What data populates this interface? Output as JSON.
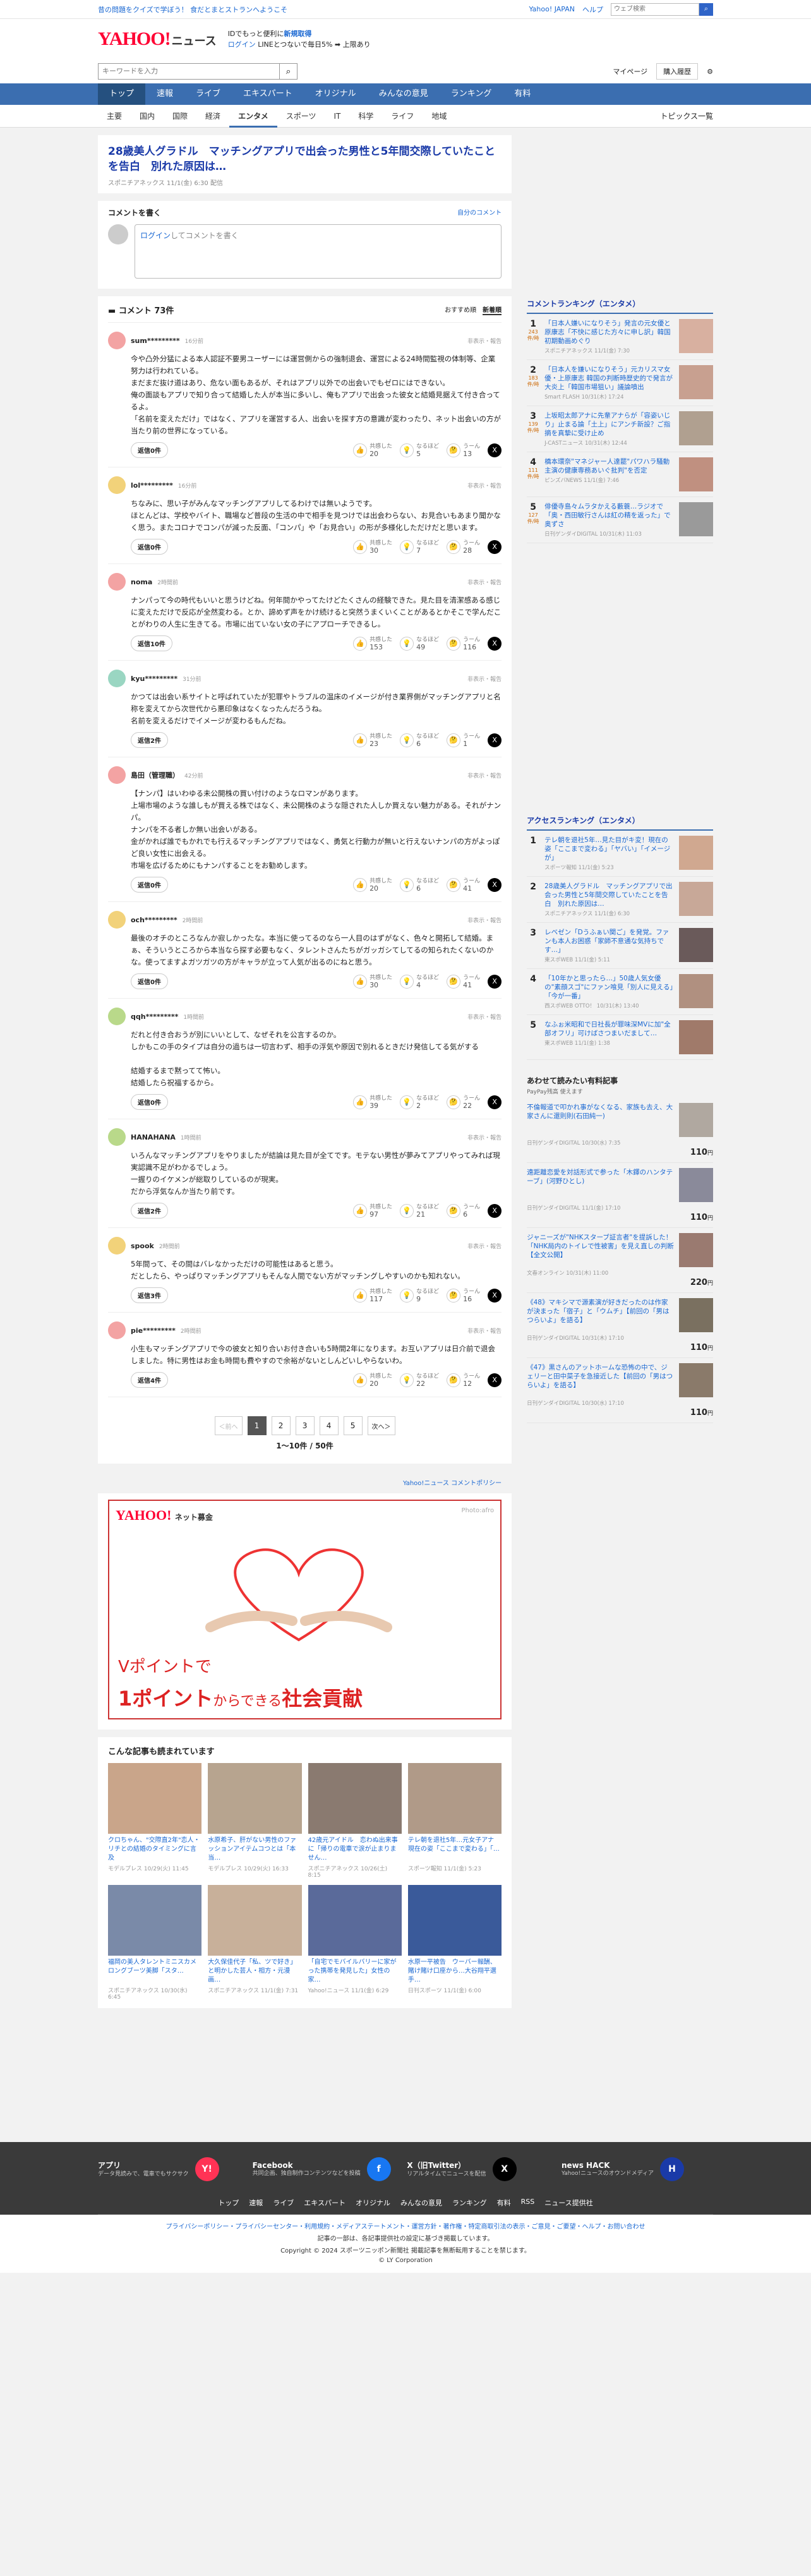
{
  "topbar": {
    "left": "昔の問題をクイズで学ぼう！ 食だとまとストランへようこそ",
    "links": [
      "Yahoo! JAPAN",
      "ヘルプ"
    ],
    "search_placeholder": "ウェブ検索"
  },
  "header": {
    "logo": "YAHOO!",
    "logo_sub": "JAPAN",
    "section": "ニュース",
    "promo_line1": "IDでもっと便利に",
    "promo_new": "新規取得",
    "promo_line2_a": "ログイン",
    "promo_line2_b": "LINEとつないで毎日5% ➡ 上限あり"
  },
  "search": {
    "placeholder": "キーワードを入力",
    "mypage": "マイページ",
    "buy": "購入履歴"
  },
  "mainnav": [
    "トップ",
    "速報",
    "ライブ",
    "エキスパート",
    "オリジナル",
    "みんなの意見",
    "ランキング",
    "有料"
  ],
  "subnav": [
    "主要",
    "国内",
    "国際",
    "経済",
    "エンタメ",
    "スポーツ",
    "IT",
    "科学",
    "ライフ",
    "地域"
  ],
  "subnav_right": "トピックス一覧",
  "article": {
    "title": "28歳美人グラドル　マッチングアプリで出会った男性と5年間交際していたことを告白　別れた原因は…",
    "meta": "スポニチアネックス 11/1(金) 6:30 配信"
  },
  "write": {
    "title": "コメントを書く",
    "policy": "自分のコメント",
    "login": "ログイン",
    "placeholder": "してコメントを書く"
  },
  "comments": {
    "title": "コメント 73件",
    "sort": [
      "おすすめ順",
      "新着順"
    ],
    "items": [
      {
        "name": "sum*********",
        "time": "16分前",
        "report": "非表示・報告",
        "color": "#f3a3a3",
        "body": "今や凸外分猛による本人認証不要男ユーザーには運営側からの強制退会、運営による24時間監視の体制等、企業努力は行われている。\nまだまだ抜け道はあり、危ない面もあるが、それはアプリ以外での出会いでもゼロにはできない。\n俺の面談もアプリで知り合って結婚した人が本当に多いし、俺もアプリで出会った彼女と結婚見据えて付き合ってるよ。\n「名前を変えただけ」ではなく、アプリを運営する人、出会いを探す方の意識が変わったり、ネット出会いの方が当たり前の世界になっている。",
        "reply": "返信0件",
        "r1": "20",
        "r2": "5",
        "r3": "13"
      },
      {
        "name": "lol*********",
        "time": "16分前",
        "report": "非表示・報告",
        "color": "#f2d27a",
        "body": "ちなみに、思い子がみんなマッチングアプリしてるわけでは無いようです。\nほとんどは、学校やバイト、職場など普段の生活の中で相手を見つけでは出会わらない、お見合いもあまり聞かなく思う。またコロナでコンパが減った反面、「コンパ」や「お見合い」の形が多様化しただけだと思います。",
        "reply": "返信0件",
        "r1": "30",
        "r2": "7",
        "r3": "28"
      },
      {
        "name": "noma",
        "time": "2時間前",
        "report": "非表示・報告",
        "color": "#f3a3a3",
        "body": "ナンパって今の時代もいいと思うけどね。何年間かやってたけどたくさんの経験できた。見た目を清潔感ある感じに変えただけで反応が全然変わる。とか、諦めず声をかけ続けると突然うまくいくことがあるとかそこで学んだことがわりの人生に生きてる。市場に出ていない女の子にアプローチできるし。",
        "reply": "返信10件",
        "r1": "153",
        "r2": "49",
        "r3": "116"
      },
      {
        "name": "kyu*********",
        "time": "31分前",
        "report": "非表示・報告",
        "color": "#9ad6c2",
        "body": "かつては出会い系サイトと呼ばれていたが犯罪やトラブルの温床のイメージが付き業界側がマッチングアプリと名称を変えてから次世代から悪印象はなくなったんだろうね。\n名前を変えるだけでイメージが変わるもんだね。",
        "reply": "返信2件",
        "r1": "23",
        "r2": "6",
        "r3": "1"
      },
      {
        "name": "島田（管理職）",
        "time": "42分前",
        "report": "非表示・報告",
        "color": "#f3a3a3",
        "body": "【ナンパ】はいわゆる未公開株の買い付けのようなロマンがあります。\n上場市場のような誰しもが買える株ではなく、未公開株のような隠された人しか買えない魅力がある。それがナンパ。\nナンパを不る者しか無い出会いがある。\n金がかれば誰でもかれでも行えるマッチングアプリではなく、勇気と行動力が無いと行えないナンパの方がよっぽど良い女性に出会える。\n市場を広げるためにもナンパすることをお勧めします。",
        "reply": "返信0件",
        "r1": "20",
        "r2": "6",
        "r3": "41"
      },
      {
        "name": "och*********",
        "time": "2時間前",
        "report": "非表示・報告",
        "color": "#f2d27a",
        "body": "最後のオチのところなんか寂しかったな。本当に使ってるのなら一人目のはずがなく、色々と開拓して結婚。まぁ、そういうところから本当なら探す必要もなく、タレントさんたちがガッガシてしてるの知られたくないのかな。使ってますよガツガツの方がキャラが立って人気が出るのにねと思う。",
        "reply": "返信0件",
        "r1": "30",
        "r2": "4",
        "r3": "41"
      },
      {
        "name": "qqh*********",
        "time": "1時間前",
        "report": "非表示・報告",
        "color": "#b9d98a",
        "body": "だれと付き合おうが別にいいとして、なぜそれを公言するのか。\nしかもこの手のタイプは自分の過ちは一切言わず、相手の浮気や原因で別れるときだけ発信してる気がする\n\n結婚するまで黙ってて怖い。\n結婚したら祝福するから。",
        "reply": "返信0件",
        "r1": "39",
        "r2": "2",
        "r3": "22"
      },
      {
        "name": "HANAHANA",
        "time": "1時間前",
        "report": "非表示・報告",
        "color": "#b9d98a",
        "body": "いろんなマッチングアプリをやりましたが結論は見た目が全てです。モテない男性が夢みてアプリやってみれば現実認識不足がわかるでしょう。\n一握りのイケメンが総取りしているのが現実。\nだから浮気なんか当たり前です。",
        "reply": "返信2件",
        "r1": "97",
        "r2": "21",
        "r3": "6"
      },
      {
        "name": "spook",
        "time": "2時間前",
        "report": "非表示・報告",
        "color": "#f2d27a",
        "body": "5年間って、その間はバレなかっただけの可能性はあると思う。\nだとしたら、やっぱりマッチングアプリもそんな人間でない方がマッチングしやすいのかも知れない。",
        "reply": "返信3件",
        "r1": "117",
        "r2": "9",
        "r3": "16"
      },
      {
        "name": "pie*********",
        "time": "2時間前",
        "report": "非表示・報告",
        "color": "#f3a3a3",
        "body": "小生もマッチングアプリで今の彼女と知り合いお付き合いも5時間2年になります。お互いアプリは日介前で退会しました。特に男性はお金も時間も費やすので余裕がないとしんどいしやらないわ。",
        "reply": "返信4件",
        "r1": "20",
        "r2": "22",
        "r3": "12"
      }
    ],
    "react_labels": [
      "共感した",
      "なるほど",
      "うーん"
    ]
  },
  "pager": {
    "prev": "＜前へ",
    "pages": [
      "1",
      "2",
      "3",
      "4",
      "5"
    ],
    "next": "次へ＞",
    "count": "1〜10件 / 50件"
  },
  "policy_link": "Yahoo!ニュース コメントポリシー",
  "ad": {
    "logo": "YAHOO!",
    "sub": "ネット募金",
    "photo": "Photo:afro",
    "t1": "Vポイント",
    "t1b": "で",
    "t2a": "1ポイント",
    "t2b": "からできる",
    "t2c": "社会貢献"
  },
  "also": {
    "title": "こんな記事も読まれています",
    "items": [
      {
        "t": "クロちゃん、\"交際直2年\"恋人・リチとの結婚のタイミングに言及",
        "s": "モデルプレス 10/29(火) 11:45",
        "c": "#c9a58a"
      },
      {
        "t": "水原希子、肝がない男性のファッションアイテムコつとは「本当…",
        "s": "モデルプレス 10/29(火) 16:33",
        "c": "#b7a48f"
      },
      {
        "t": "42歳元アイドル　恋わぬ出来事に「帰りの電車で涙が止まりません…",
        "s": "スポニチアネックス 10/26(土) 8:15",
        "c": "#8a7a70"
      },
      {
        "t": "テレ朝を退社5年…元女子アナ 現在の姿「ここまで変わる」「…",
        "s": "スポーツ報知 11/1(金) 5:23",
        "c": "#b09a88"
      },
      {
        "t": "福岡の美人タレントミニスカメロングブーツ美脚「スタ…",
        "s": "スポニチアネックス 10/30(水) 6:45",
        "c": "#7a8aa8"
      },
      {
        "t": "大久保佳代子「私、ツで好き」と明かした芸人・相方・元漫画…",
        "s": "スポニチアネックス 11/1(金) 7:31",
        "c": "#c8b09a"
      },
      {
        "t": "「自宅でモバイルバリーに家がった携帯を発見した」女性の家…",
        "s": "Yahoo!ニュース 11/1(金) 6:29",
        "c": "#5a6a9a"
      },
      {
        "t": "水原一平被告　ウーバー報酬、賭け賭け口座から…大谷翔平選手…",
        "s": "日刊スポーツ 11/1(金) 6:00",
        "c": "#3a5a9a"
      }
    ]
  },
  "side_rank1": {
    "title": "コメントランキング（エンタメ）",
    "items": [
      {
        "no": "1",
        "cnt": "243",
        "u": "件/時",
        "t": "「日本人嫌いになりそう」発言の元女優と原康志「不快に感じた方々に申し訳」韓国初期動画めぐり",
        "s": "スポニチアネックス 11/1(金) 7:30",
        "c": "#d8b0a0"
      },
      {
        "no": "2",
        "cnt": "183",
        "u": "件/時",
        "t": "「日本人を嫌いになりそう」元カリスマ女優・上原康志 韓国の判断時歴史的で発言が大炎上「韓国市場狙い」議論噴出",
        "s": "Smart FLASH 10/31(木) 17:24",
        "c": "#c8a090"
      },
      {
        "no": "3",
        "cnt": "139",
        "u": "件/時",
        "t": "上坂昭太郎アナに先輩アナらが「容姿いじり」止まる論「土上」にアンチ新設？ご指摘を真摯に受け止め",
        "s": "J-CASTニュース 10/31(木) 12:44",
        "c": "#b0a090"
      },
      {
        "no": "4",
        "cnt": "111",
        "u": "件/時",
        "t": "橋本環奈\"マネジャー人達罷\"パワハラ騒動　主演の健康専務あいぐ批判\"を否定",
        "s": "ピンズバNEWS 11/1(金) 7:46",
        "c": "#c09080"
      },
      {
        "no": "5",
        "cnt": "127",
        "u": "件/時",
        "t": "俳優寺島々ムラタかえる藪蓑…ラジオで「奥・西田敏行さんは紅の精を返った」で奥ずさ",
        "s": "日刊ゲンダイDIGITAL 10/31(木) 11:03",
        "c": "#9a9a9a"
      }
    ]
  },
  "side_rank2": {
    "title": "アクセスランキング（エンタメ）",
    "items": [
      {
        "no": "1",
        "t": "テレ朝を退社5年…見た目がキ変！現在の姿「ここまで変わる」「ヤバい」「イメージが」",
        "s": "スポーツ報知 11/1(金) 5:23",
        "c": "#d0a890"
      },
      {
        "no": "2",
        "t": "28歳美人グラドル　マッチングアプリで出会った男性と5年間交際していたことを告白　別れた原因は…",
        "s": "スポニチアネックス 11/1(金) 6:30",
        "c": "#c8a898"
      },
      {
        "no": "3",
        "t": "レベゼン「Dうふぁい関ご」を発覚。ファンも本人お困惑「家師不意通な気持ちです…」",
        "s": "東スポWEB 11/1(金) 5:11",
        "c": "#6a5a5a"
      },
      {
        "no": "4",
        "t": "「10年かと思ったら…」50歳人気女優の\"素顔スゴ\"にファン喰見「別人に見える」「今が一番」",
        "s": "西スポWEB OTTO！ 10/31(木) 13:40",
        "c": "#b09080"
      },
      {
        "no": "5",
        "t": "なふぉ米昭和で日社長が罪味深MVに加\"全部オフリ」可けばさつまいだまして…",
        "s": "東スポWEB 11/1(金) 1:38",
        "c": "#a07a6a"
      }
    ]
  },
  "paid": {
    "title": "あわせて読みたい有料記事",
    "sub": "PayPay残高 使えます",
    "items": [
      {
        "t": "不倫報道で叩かれ事がなくなる、家族も去え、大家さんに還則則(石田純一)",
        "s": "日刊ゲンダイDIGITAL 10/30(水) 7:35",
        "p": "110",
        "c": "#b0a8a0"
      },
      {
        "t": "遠距離恋愛を対話形式で参った「木鐸のハンタテーブ」(河野ひとし)",
        "s": "日刊ゲンダイDIGITAL 11/1(金) 17:10",
        "p": "110",
        "c": "#8a8a9a"
      },
      {
        "t": "ジャニーズが\"NHKスターブ証言者\"を提訴した！「NHK局内のトイレで性被害」を見え直しの判断 【全文公開】",
        "s": "文春オンライン 10/31(木) 11:00",
        "p": "220",
        "c": "#9a7a70"
      },
      {
        "t": "《48》マキシマで源素演が好きだったのは作家が決まった「宿子」と「ウムチ」【前回の「男はつらいよ」を語る】",
        "s": "日刊ゲンダイDIGITAL 10/31(木) 17:10",
        "p": "110",
        "c": "#7a7060"
      },
      {
        "t": "《47》黒さんのアットホームな恐怖の中で、ジェリーと田中菜子を急接近した【前回の「男はつらいよ」を語る】",
        "s": "日刊ゲンダイDIGITAL 10/30(水) 17:10",
        "p": "110",
        "c": "#8a7a6a"
      }
    ],
    "unit": "円"
  },
  "footer": {
    "apps": [
      {
        "t": "アプリ",
        "d": "データ見読みで、電車でもサクサク",
        "ic": "Y!",
        "c": "#ff3355"
      },
      {
        "t": "Facebook",
        "d": "共同企画、独自制作コンテンツなどを投稿",
        "ic": "f",
        "c": "#1877f2"
      },
      {
        "t": "X（旧Twitter）",
        "d": "リアルタイムでニュースを配信",
        "ic": "X",
        "c": "#000"
      },
      {
        "t": "news HACK",
        "d": "Yahoo!ニュースのオウンドメディア",
        "ic": "H",
        "c": "#1a3aa8"
      }
    ],
    "nav": [
      "トップ",
      "速報",
      "ライブ",
      "エキスパート",
      "オリジナル",
      "みんなの意見",
      "ランキング",
      "有料",
      "RSS",
      "ニュース提供社"
    ],
    "links": "プライバシーポリシー・プライバシーセンター・利用規約・メディアステートメント・運営方針・著作権・特定商取引法の表示・ご意見・ご要望・ヘルプ・お問い合わせ",
    "notice": "記事の一部は、各記事提供社の設定に基づき掲載しています。",
    "copyright": "Copyright © 2024 スポーツニッポン新聞社 掲載記事を無断転用することを禁じます。",
    "corp": "© LY Corporation"
  }
}
